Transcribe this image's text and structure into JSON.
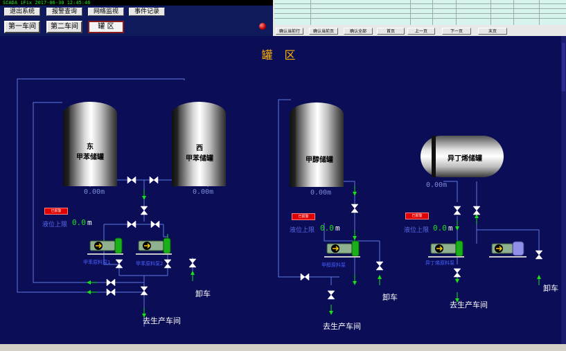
{
  "header": {
    "status_line": "SCADA iFix   2017-06-30  12:45:46",
    "buttons_row1": [
      "退出系统",
      "报警查询",
      "网络监视",
      "事件记录"
    ],
    "buttons_row2": [
      "第一车间",
      "第二车间",
      "罐 区"
    ]
  },
  "alarm_table": {
    "page_buttons": [
      "确认当前行",
      "确认当前页",
      "确认全部",
      "首页",
      "上一页",
      "下一页",
      "末页"
    ]
  },
  "main": {
    "title": "罐 区",
    "tanks": {
      "east": {
        "label_line1": "东",
        "label_line2": "甲苯储罐",
        "level": "0.00m"
      },
      "west": {
        "label_line1": "西",
        "label_line2": "甲苯储罐",
        "level": "0.00m"
      },
      "methanol": {
        "label": "甲醇储罐",
        "level": "0.00m"
      },
      "isobutylene": {
        "label": "异丁烯储罐",
        "level": "0.00m"
      }
    },
    "alarm_badges": [
      "已报警",
      "已报警",
      "已报警"
    ],
    "level_limits": [
      {
        "label": "液位上限",
        "value": "0.0",
        "unit": "m"
      },
      {
        "label": "液位上限",
        "value": "0.0",
        "unit": "m"
      },
      {
        "label": "液位上限",
        "value": "0.0",
        "unit": "m"
      }
    ],
    "pumps": [
      "甲苯原料泵1",
      "甲苯原料泵2",
      "甲醇原料泵",
      "异丁烯原料泵"
    ],
    "destinations": {
      "unload_1": "卸车",
      "unload_2": "卸车",
      "unload_3": "卸车",
      "to_workshop_1": "去生产车间",
      "to_workshop_2": "去生产车间",
      "to_workshop_3": "去生产车间"
    }
  },
  "colors": {
    "background": "#0b0d57",
    "title": "#ffb400",
    "pipe": "#5c7be0",
    "flow_arrow": "#19e019",
    "alarm": "#e00000"
  }
}
